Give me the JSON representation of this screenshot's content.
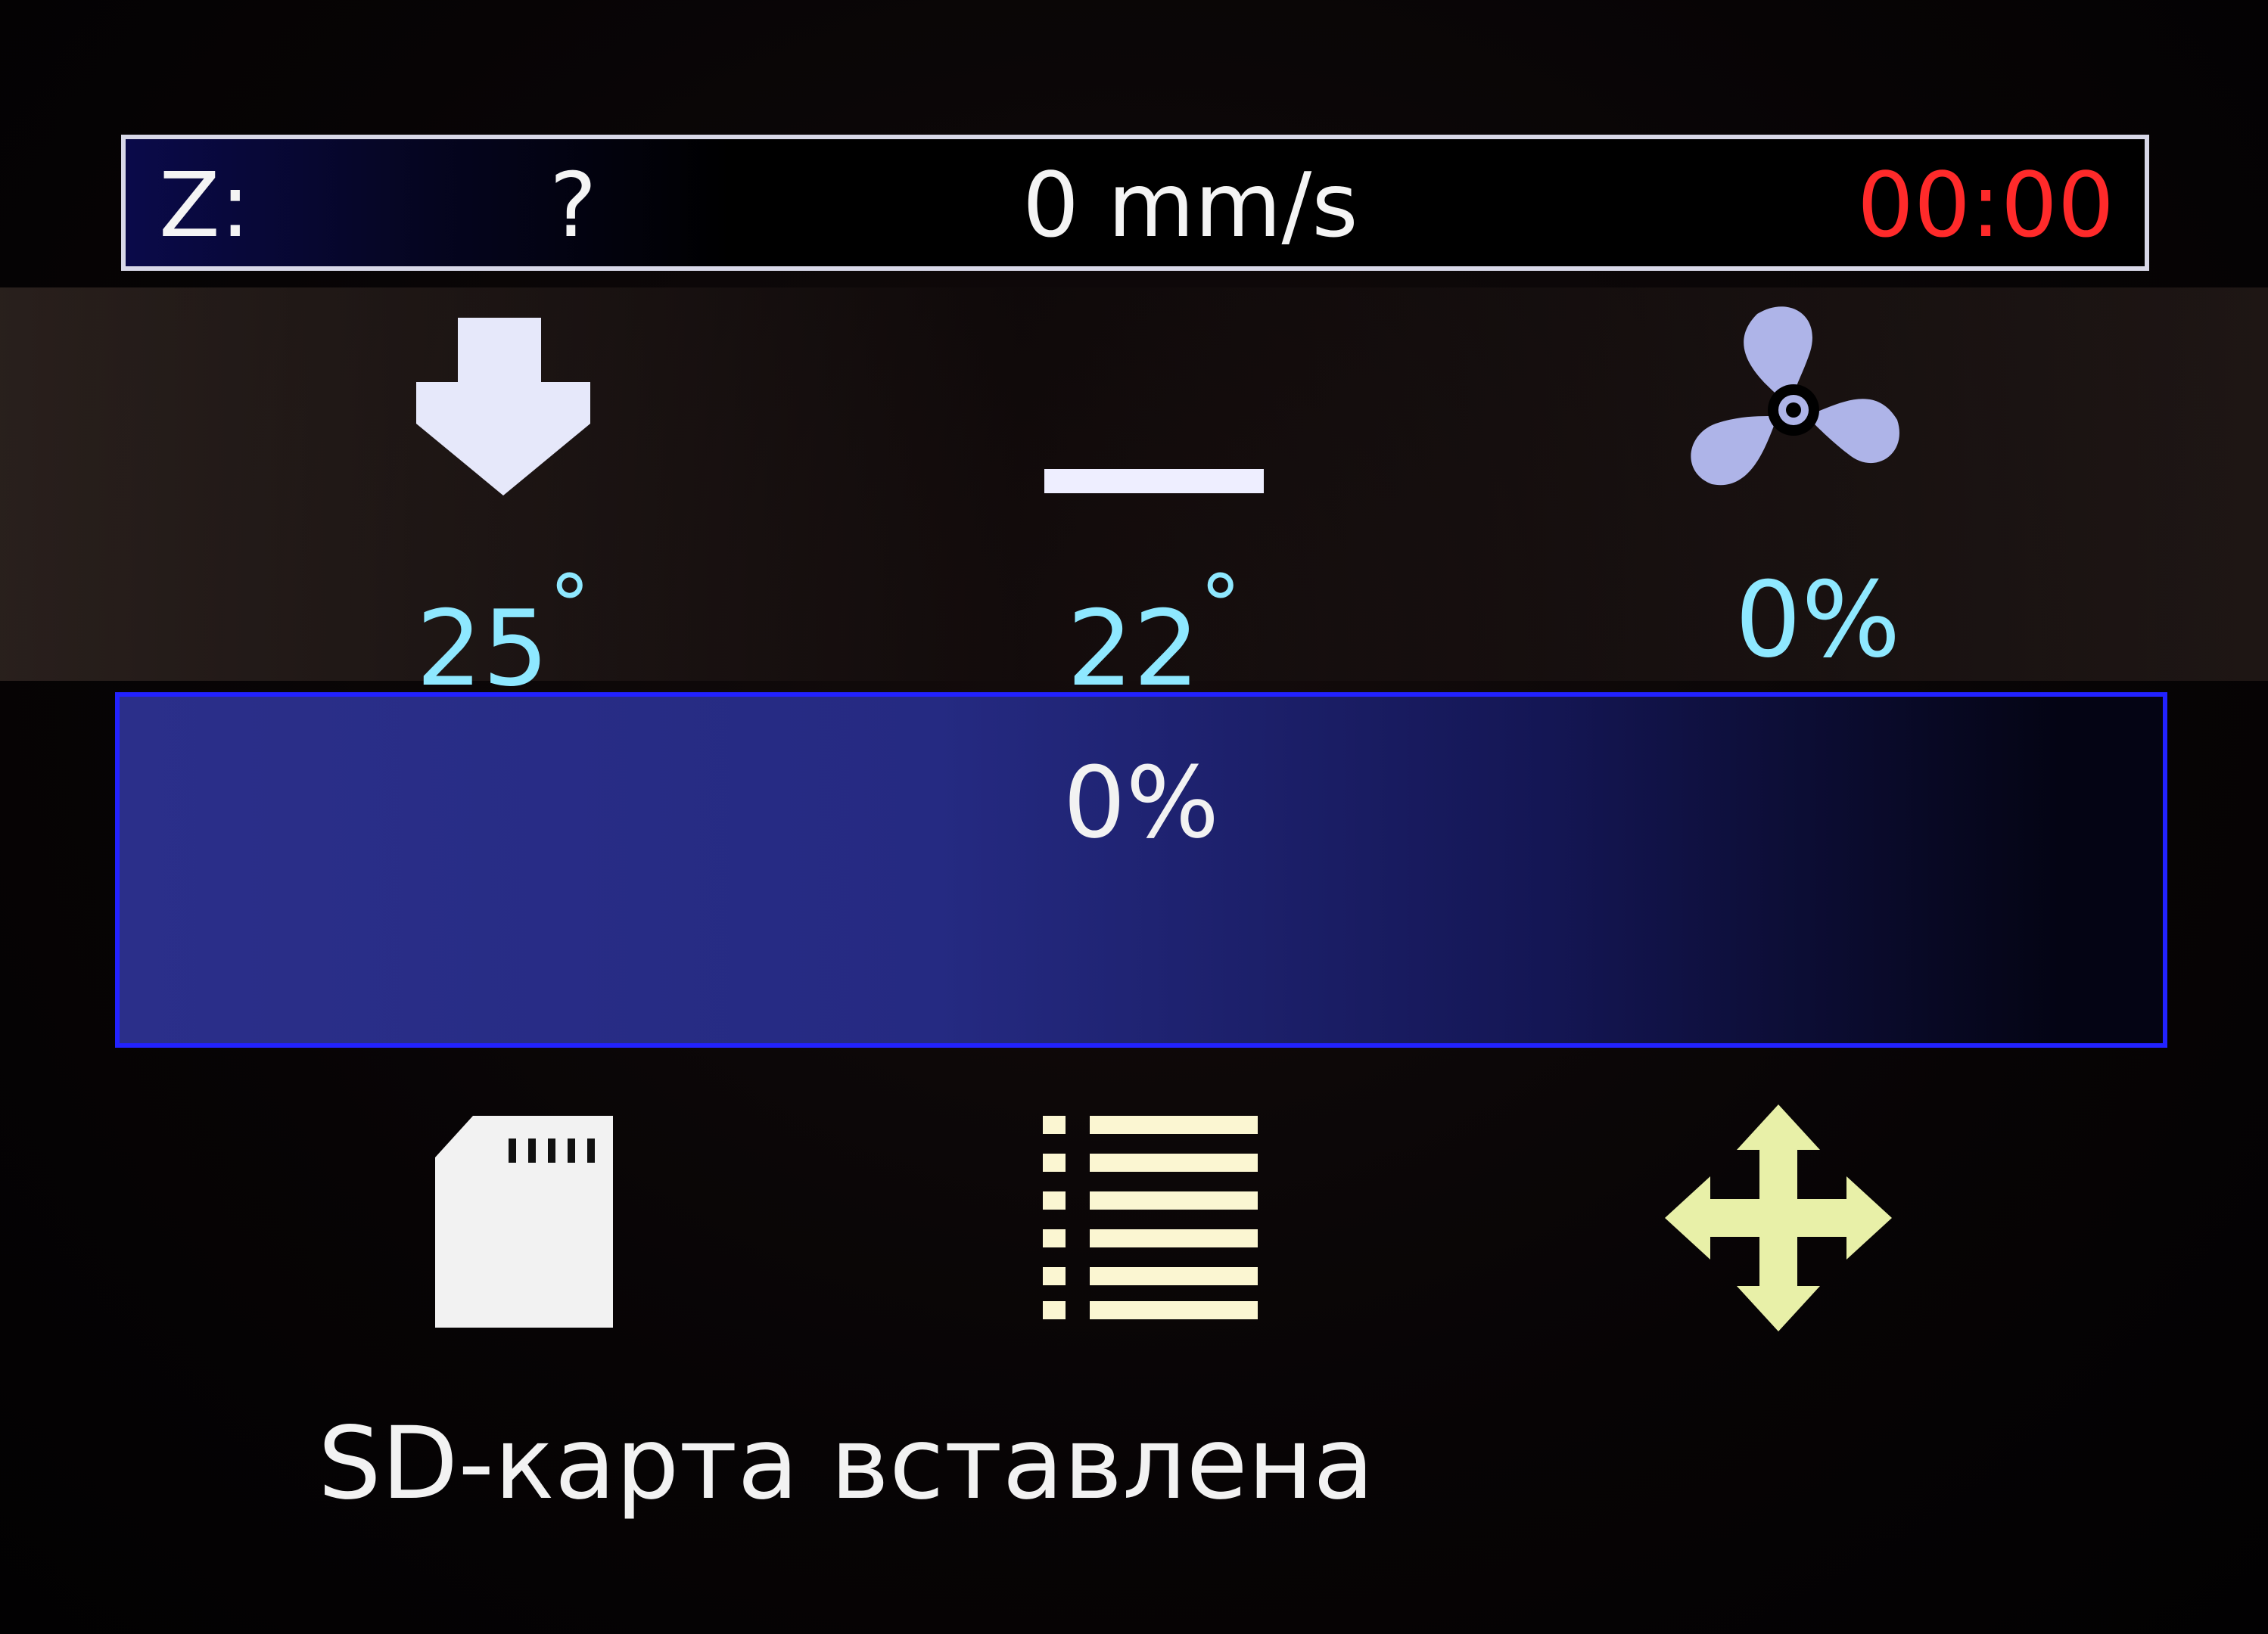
{
  "status_bar": {
    "z_label": "Z:",
    "z_value": "?",
    "speed": "0 mm/s",
    "elapsed_time": "00:00"
  },
  "readouts": {
    "extruder": {
      "icon": "extruder-down-arrow-icon",
      "value": "25",
      "unit": "°"
    },
    "bed": {
      "icon": "heated-bed-icon",
      "value": "22",
      "unit": "°"
    },
    "fan": {
      "icon": "fan-icon",
      "value": "0%"
    }
  },
  "progress": {
    "label": "0%",
    "value_percent": 0
  },
  "menu_buttons": [
    {
      "icon": "sd-card-icon"
    },
    {
      "icon": "menu-list-icon"
    },
    {
      "icon": "move-arrows-icon"
    }
  ],
  "message": "SD-карта вставлена",
  "colors": {
    "timer": "#ff2a2a",
    "temperature": "#8ee8ff",
    "progress_border": "#2222ff",
    "move_icon": "#e8f0a8"
  }
}
